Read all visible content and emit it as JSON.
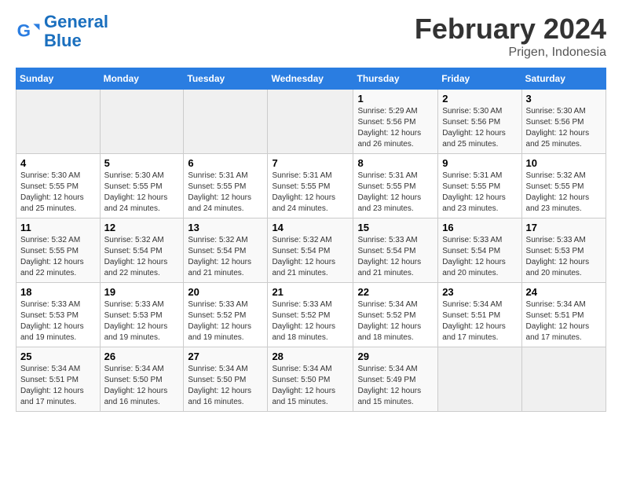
{
  "logo": {
    "line1": "General",
    "line2": "Blue"
  },
  "title": "February 2024",
  "subtitle": "Prigen, Indonesia",
  "days_of_week": [
    "Sunday",
    "Monday",
    "Tuesday",
    "Wednesday",
    "Thursday",
    "Friday",
    "Saturday"
  ],
  "weeks": [
    [
      {
        "day": "",
        "info": ""
      },
      {
        "day": "",
        "info": ""
      },
      {
        "day": "",
        "info": ""
      },
      {
        "day": "",
        "info": ""
      },
      {
        "day": "1",
        "info": "Sunrise: 5:29 AM\nSunset: 5:56 PM\nDaylight: 12 hours and 26 minutes."
      },
      {
        "day": "2",
        "info": "Sunrise: 5:30 AM\nSunset: 5:56 PM\nDaylight: 12 hours and 25 minutes."
      },
      {
        "day": "3",
        "info": "Sunrise: 5:30 AM\nSunset: 5:56 PM\nDaylight: 12 hours and 25 minutes."
      }
    ],
    [
      {
        "day": "4",
        "info": "Sunrise: 5:30 AM\nSunset: 5:55 PM\nDaylight: 12 hours and 25 minutes."
      },
      {
        "day": "5",
        "info": "Sunrise: 5:30 AM\nSunset: 5:55 PM\nDaylight: 12 hours and 24 minutes."
      },
      {
        "day": "6",
        "info": "Sunrise: 5:31 AM\nSunset: 5:55 PM\nDaylight: 12 hours and 24 minutes."
      },
      {
        "day": "7",
        "info": "Sunrise: 5:31 AM\nSunset: 5:55 PM\nDaylight: 12 hours and 24 minutes."
      },
      {
        "day": "8",
        "info": "Sunrise: 5:31 AM\nSunset: 5:55 PM\nDaylight: 12 hours and 23 minutes."
      },
      {
        "day": "9",
        "info": "Sunrise: 5:31 AM\nSunset: 5:55 PM\nDaylight: 12 hours and 23 minutes."
      },
      {
        "day": "10",
        "info": "Sunrise: 5:32 AM\nSunset: 5:55 PM\nDaylight: 12 hours and 23 minutes."
      }
    ],
    [
      {
        "day": "11",
        "info": "Sunrise: 5:32 AM\nSunset: 5:55 PM\nDaylight: 12 hours and 22 minutes."
      },
      {
        "day": "12",
        "info": "Sunrise: 5:32 AM\nSunset: 5:54 PM\nDaylight: 12 hours and 22 minutes."
      },
      {
        "day": "13",
        "info": "Sunrise: 5:32 AM\nSunset: 5:54 PM\nDaylight: 12 hours and 21 minutes."
      },
      {
        "day": "14",
        "info": "Sunrise: 5:32 AM\nSunset: 5:54 PM\nDaylight: 12 hours and 21 minutes."
      },
      {
        "day": "15",
        "info": "Sunrise: 5:33 AM\nSunset: 5:54 PM\nDaylight: 12 hours and 21 minutes."
      },
      {
        "day": "16",
        "info": "Sunrise: 5:33 AM\nSunset: 5:54 PM\nDaylight: 12 hours and 20 minutes."
      },
      {
        "day": "17",
        "info": "Sunrise: 5:33 AM\nSunset: 5:53 PM\nDaylight: 12 hours and 20 minutes."
      }
    ],
    [
      {
        "day": "18",
        "info": "Sunrise: 5:33 AM\nSunset: 5:53 PM\nDaylight: 12 hours and 19 minutes."
      },
      {
        "day": "19",
        "info": "Sunrise: 5:33 AM\nSunset: 5:53 PM\nDaylight: 12 hours and 19 minutes."
      },
      {
        "day": "20",
        "info": "Sunrise: 5:33 AM\nSunset: 5:52 PM\nDaylight: 12 hours and 19 minutes."
      },
      {
        "day": "21",
        "info": "Sunrise: 5:33 AM\nSunset: 5:52 PM\nDaylight: 12 hours and 18 minutes."
      },
      {
        "day": "22",
        "info": "Sunrise: 5:34 AM\nSunset: 5:52 PM\nDaylight: 12 hours and 18 minutes."
      },
      {
        "day": "23",
        "info": "Sunrise: 5:34 AM\nSunset: 5:51 PM\nDaylight: 12 hours and 17 minutes."
      },
      {
        "day": "24",
        "info": "Sunrise: 5:34 AM\nSunset: 5:51 PM\nDaylight: 12 hours and 17 minutes."
      }
    ],
    [
      {
        "day": "25",
        "info": "Sunrise: 5:34 AM\nSunset: 5:51 PM\nDaylight: 12 hours and 17 minutes."
      },
      {
        "day": "26",
        "info": "Sunrise: 5:34 AM\nSunset: 5:50 PM\nDaylight: 12 hours and 16 minutes."
      },
      {
        "day": "27",
        "info": "Sunrise: 5:34 AM\nSunset: 5:50 PM\nDaylight: 12 hours and 16 minutes."
      },
      {
        "day": "28",
        "info": "Sunrise: 5:34 AM\nSunset: 5:50 PM\nDaylight: 12 hours and 15 minutes."
      },
      {
        "day": "29",
        "info": "Sunrise: 5:34 AM\nSunset: 5:49 PM\nDaylight: 12 hours and 15 minutes."
      },
      {
        "day": "",
        "info": ""
      },
      {
        "day": "",
        "info": ""
      }
    ]
  ]
}
